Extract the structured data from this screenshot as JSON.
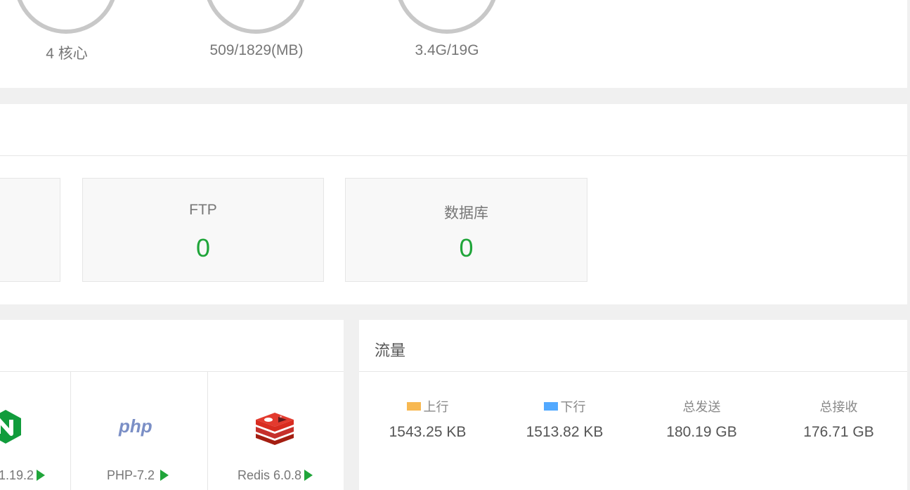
{
  "gauges": [
    {
      "label": "4 核心"
    },
    {
      "label": "509/1829(MB)"
    },
    {
      "label": "3.4G/19G"
    }
  ],
  "overview": {
    "cards": [
      {
        "label": "FTP",
        "value": "0"
      },
      {
        "label": "数据库",
        "value": "0"
      }
    ]
  },
  "software": {
    "items": [
      {
        "label": "1.19.2",
        "icon": "nginx-icon"
      },
      {
        "label": "PHP-7.2",
        "icon": "php-icon"
      },
      {
        "label": "Redis 6.0.8",
        "icon": "redis-icon"
      }
    ]
  },
  "traffic": {
    "title": "流量",
    "stats": [
      {
        "label": "上行",
        "value": "1543.25 KB",
        "swatch": "#f7b851"
      },
      {
        "label": "下行",
        "value": "1513.82 KB",
        "swatch": "#52a9ff"
      },
      {
        "label": "总发送",
        "value": "180.19 GB"
      },
      {
        "label": "总接收",
        "value": "176.71 GB"
      }
    ]
  },
  "colors": {
    "accent": "#20a53a",
    "gauge_ring": "#c8c8c8"
  }
}
